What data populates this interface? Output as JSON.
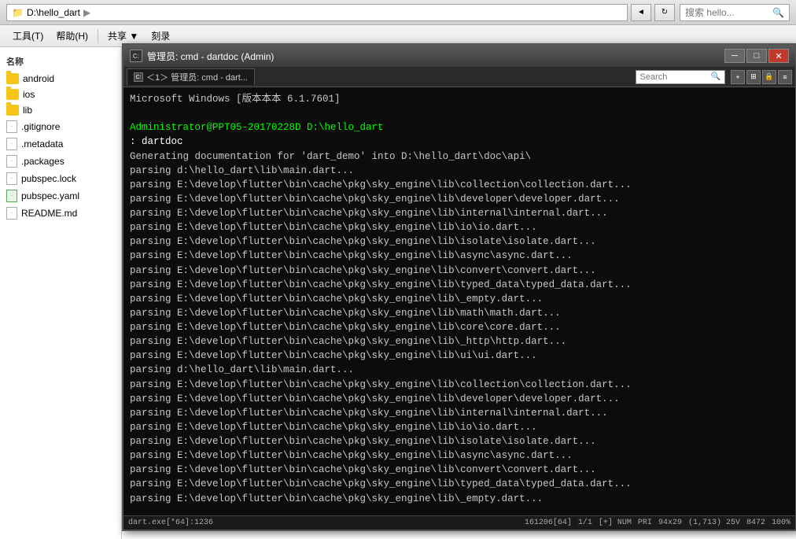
{
  "explorer": {
    "titlebar": {
      "path": "D:\\hello_dart",
      "search_placeholder": "搜索 hello...",
      "nav_back": "◄",
      "nav_refresh": "↻"
    },
    "toolbar": {
      "items": [
        "工具(T)",
        "帮助(H)"
      ],
      "actions": [
        "共享 ▼",
        "刻录"
      ]
    },
    "sidebar": {
      "header": "名称",
      "items": [
        {
          "name": "android",
          "type": "folder"
        },
        {
          "name": "ios",
          "type": "folder"
        },
        {
          "name": "lib",
          "type": "folder"
        },
        {
          "name": ".gitignore",
          "type": "file"
        },
        {
          "name": ".metadata",
          "type": "file"
        },
        {
          "name": ".packages",
          "type": "file"
        },
        {
          "name": "pubspec.lock",
          "type": "file"
        },
        {
          "name": "pubspec.yaml",
          "type": "file"
        },
        {
          "name": "README.md",
          "type": "file"
        }
      ]
    }
  },
  "cmd": {
    "titlebar": {
      "title": "管理员: cmd - dartdoc (Admin)",
      "icon_label": "C:",
      "btn_minimize": "─",
      "btn_maximize": "□",
      "btn_close": "✕"
    },
    "tab": {
      "label": "＜1＞ 管理员: cmd - dart...",
      "icon_label": "C:"
    },
    "search": {
      "placeholder": "Search",
      "label": "Search"
    },
    "content": {
      "line1": "Microsoft Windows [版本本本 6.1.7601]",
      "line2": "",
      "prompt": "Administrator@PPT05-20170228D D:\\hello_dart",
      "command": ": dartdoc",
      "output": [
        "Generating documentation for 'dart_demo' into D:\\hello_dart\\doc\\api\\",
        "parsing d:\\hello_dart\\lib\\main.dart...",
        "parsing E:\\develop\\flutter\\bin\\cache\\pkg\\sky_engine\\lib\\collection\\collection.dart...",
        "parsing E:\\develop\\flutter\\bin\\cache\\pkg\\sky_engine\\lib\\developer\\developer.dart...",
        "parsing E:\\develop\\flutter\\bin\\cache\\pkg\\sky_engine\\lib\\internal\\internal.dart...",
        "parsing E:\\develop\\flutter\\bin\\cache\\pkg\\sky_engine\\lib\\io\\io.dart...",
        "parsing E:\\develop\\flutter\\bin\\cache\\pkg\\sky_engine\\lib\\isolate\\isolate.dart...",
        "parsing E:\\develop\\flutter\\bin\\cache\\pkg\\sky_engine\\lib\\async\\async.dart...",
        "parsing E:\\develop\\flutter\\bin\\cache\\pkg\\sky_engine\\lib\\convert\\convert.dart...",
        "parsing E:\\develop\\flutter\\bin\\cache\\pkg\\sky_engine\\lib\\typed_data\\typed_data.dart...",
        "parsing E:\\develop\\flutter\\bin\\cache\\pkg\\sky_engine\\lib\\_empty.dart...",
        "parsing E:\\develop\\flutter\\bin\\cache\\pkg\\sky_engine\\lib\\math\\math.dart...",
        "parsing E:\\develop\\flutter\\bin\\cache\\pkg\\sky_engine\\lib\\core\\core.dart...",
        "parsing E:\\develop\\flutter\\bin\\cache\\pkg\\sky_engine\\lib\\_http\\http.dart...",
        "parsing E:\\develop\\flutter\\bin\\cache\\pkg\\sky_engine\\lib\\ui\\ui.dart...",
        "parsing d:\\hello_dart\\lib\\main.dart...",
        "parsing E:\\develop\\flutter\\bin\\cache\\pkg\\sky_engine\\lib\\collection\\collection.dart...",
        "parsing E:\\develop\\flutter\\bin\\cache\\pkg\\sky_engine\\lib\\developer\\developer.dart...",
        "parsing E:\\develop\\flutter\\bin\\cache\\pkg\\sky_engine\\lib\\internal\\internal.dart...",
        "parsing E:\\develop\\flutter\\bin\\cache\\pkg\\sky_engine\\lib\\io\\io.dart...",
        "parsing E:\\develop\\flutter\\bin\\cache\\pkg\\sky_engine\\lib\\isolate\\isolate.dart...",
        "parsing E:\\develop\\flutter\\bin\\cache\\pkg\\sky_engine\\lib\\async\\async.dart...",
        "parsing E:\\develop\\flutter\\bin\\cache\\pkg\\sky_engine\\lib\\convert\\convert.dart...",
        "parsing E:\\develop\\flutter\\bin\\cache\\pkg\\sky_engine\\lib\\typed_data\\typed_data.dart...",
        "parsing E:\\develop\\flutter\\bin\\cache\\pkg\\sky_engine\\lib\\_empty.dart..."
      ]
    },
    "statusbar": {
      "left": "dart.exe[*64]:1236",
      "info1": "161206[64]",
      "info2": "1/1",
      "info3": "[+] NUM",
      "info4": "PRI",
      "info5": "94x29",
      "info6": "(1,713) 25V",
      "info7": "8472",
      "info8": "100%"
    }
  }
}
